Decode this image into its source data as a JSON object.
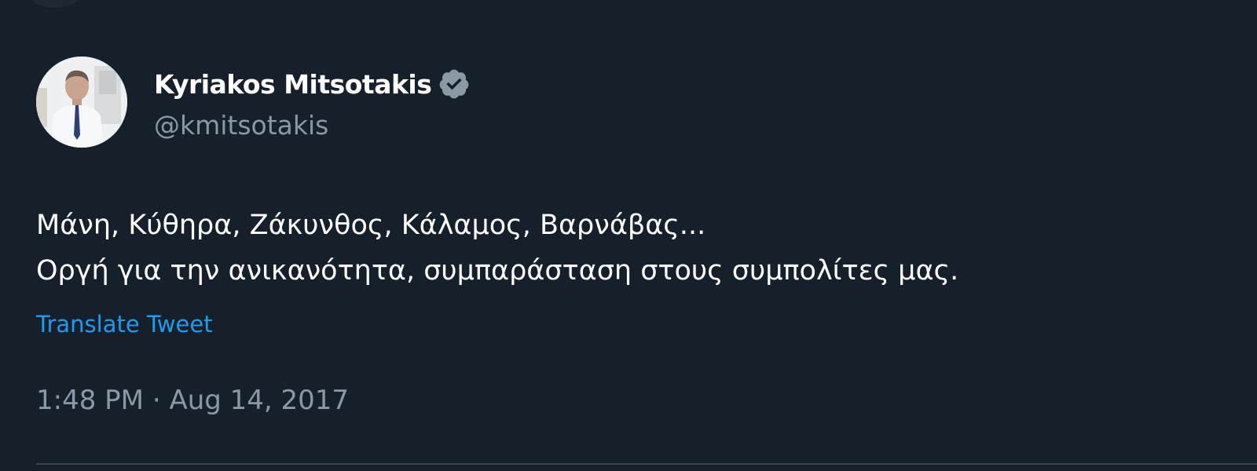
{
  "tweet": {
    "display_name": "Kyriakos Mitsotakis",
    "handle": "@kmitsotakis",
    "text_line_1": "Μάνη, Κύθηρα, Ζάκυνθος, Κάλαμος, Βαρνάβας...",
    "text_line_2": "Οργή για την ανικανότητα, συμπαράσταση στους συμπολίτες μας.",
    "translate_label": "Translate Tweet",
    "time": "1:48 PM",
    "separator": "·",
    "date": "Aug 14, 2017"
  },
  "icons": {
    "verified": "verified-badge-icon",
    "avatar": "profile-photo"
  },
  "colors": {
    "background": "#15202b",
    "text": "#ffffff",
    "secondary_text": "#8b98a5",
    "link": "#1d9bf0",
    "verified_badge": "#8b98a5"
  }
}
